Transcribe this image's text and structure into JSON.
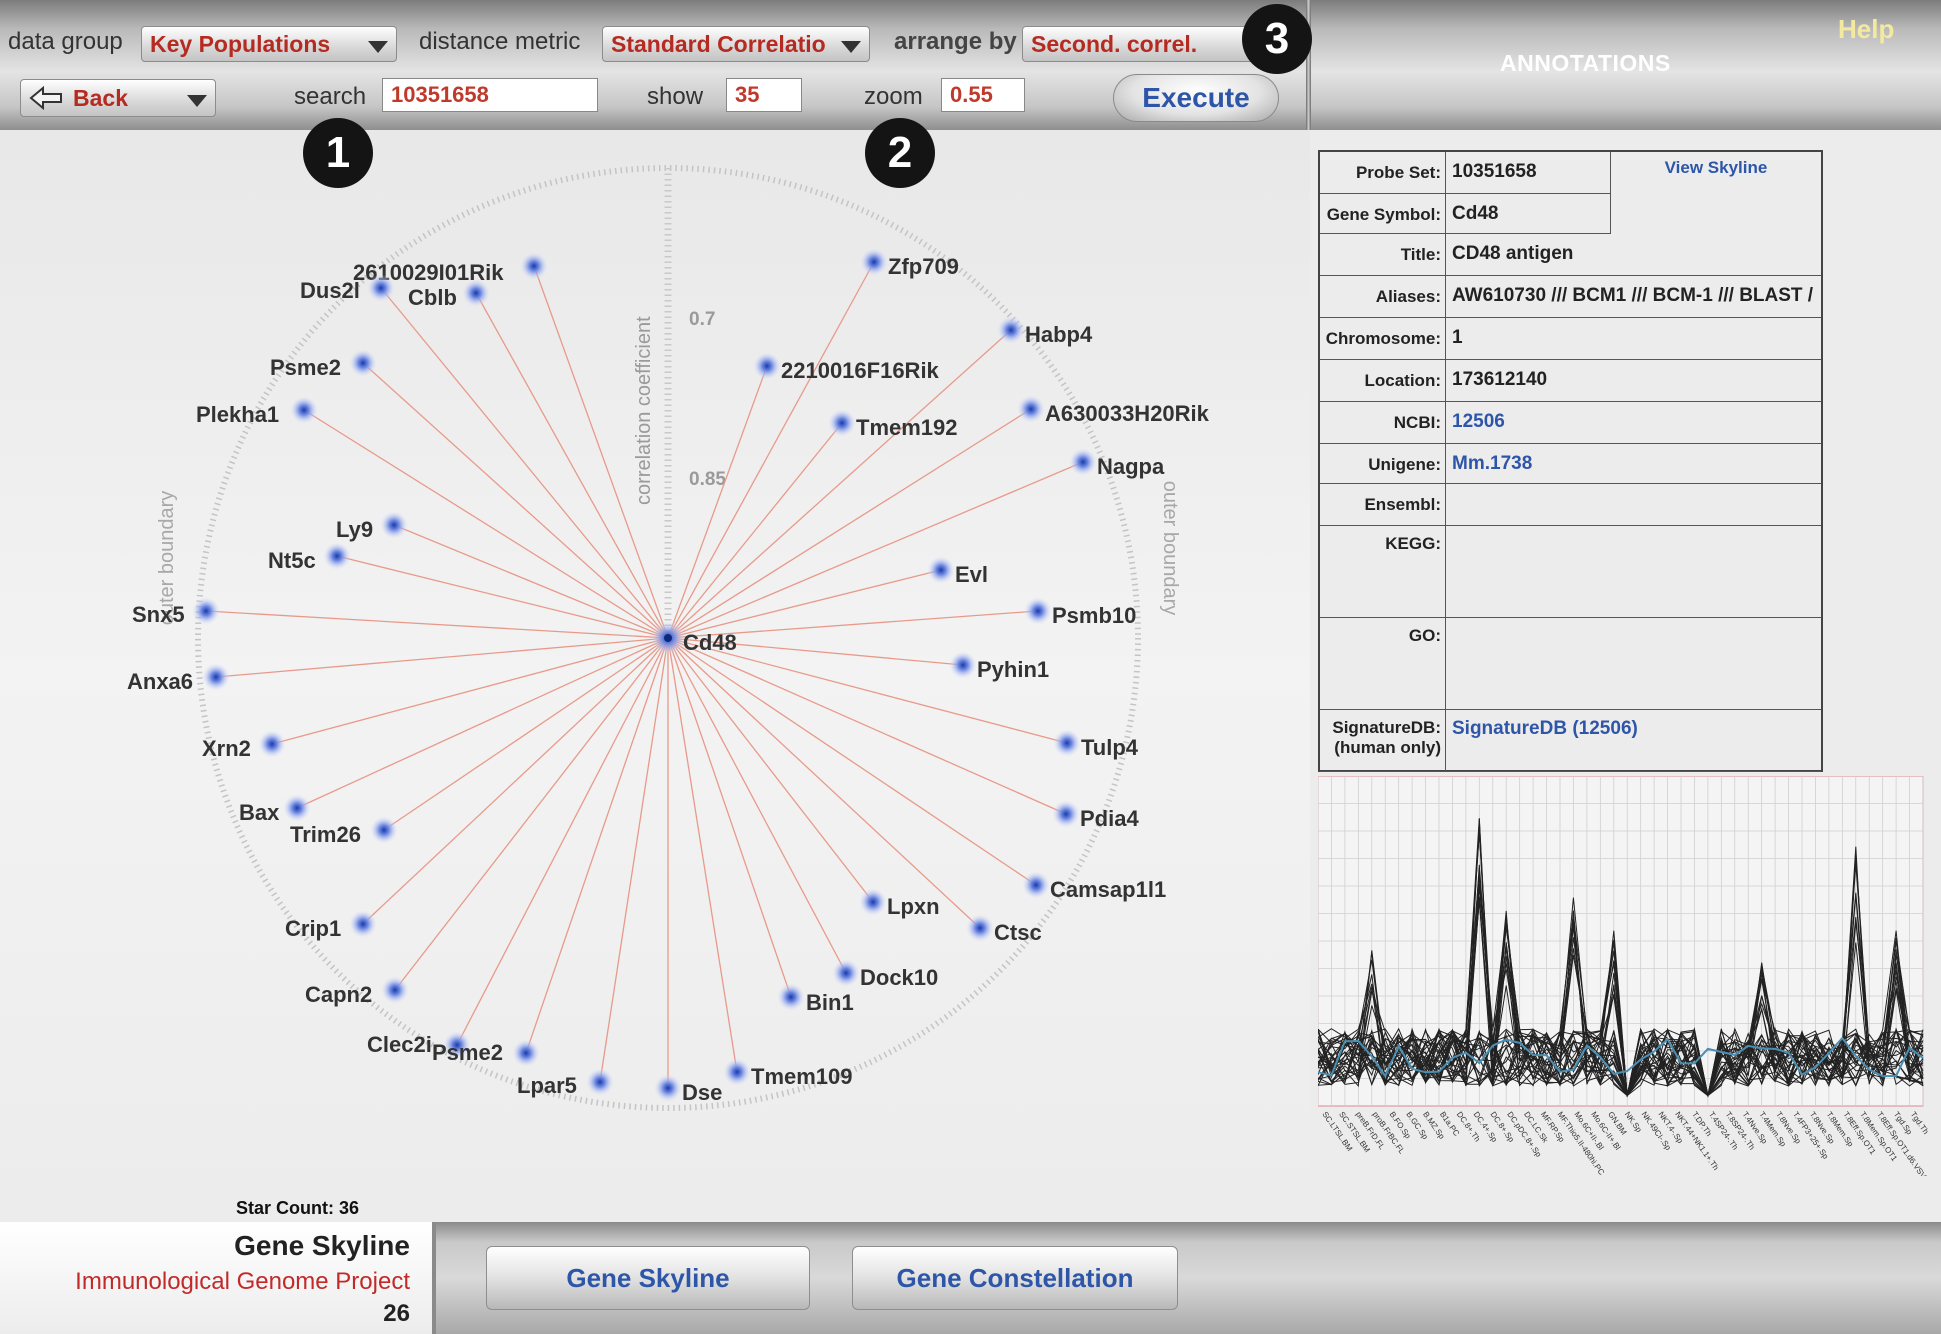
{
  "controls": {
    "data_group_label": "data group",
    "data_group_value": "Key Populations",
    "distance_metric_label": "distance metric",
    "distance_metric_value": "Standard Correlatio",
    "arrange_by_label": "arrange by",
    "arrange_by_value": "Second. correl.",
    "back_label": "Back",
    "search_label": "search",
    "search_value": "10351658",
    "show_label": "show",
    "show_value": "35",
    "zoom_label": "zoom",
    "zoom_value": "0.55",
    "execute_label": "Execute",
    "help_label": "Help",
    "annotations_title": "ANNOTATIONS"
  },
  "callouts": [
    "1",
    "2",
    "3"
  ],
  "constellation": {
    "center_gene": "Cd48",
    "axis_label": "correlation coefficient",
    "tick_07": "0.7",
    "tick_085": "0.85",
    "outer_boundary_left": "outer boundary",
    "outer_boundary_right": "outer boundary",
    "genes": [
      "2610029I01Rik",
      "Dus2l",
      "Cblb",
      "Psme2",
      "Plekha1",
      "Ly9",
      "Nt5c",
      "Snx5",
      "Anxa6",
      "Xrn2",
      "Bax",
      "Trim26",
      "Crip1",
      "Capn2",
      "Clec2i",
      "Psme2",
      "Lpar5",
      "Dse",
      "Tmem109",
      "Bin1",
      "Dock10",
      "Lpxn",
      "Ctsc",
      "Camsap1l1",
      "Pdia4",
      "Tulp4",
      "Pyhin1",
      "Psmb10",
      "Evl",
      "Nagpa",
      "A630033H20Rik",
      "Tmem192",
      "2210016F16Rik",
      "Habp4",
      "Zfp709"
    ]
  },
  "annotations": {
    "view_skyline": "View Skyline",
    "rows": [
      {
        "key": "Probe Set:",
        "value": "10351658",
        "link": false
      },
      {
        "key": "Gene Symbol:",
        "value": "Cd48",
        "link": false
      },
      {
        "key": "Title:",
        "value": "CD48 antigen",
        "link": false
      },
      {
        "key": "Aliases:",
        "value": "AW610730 /// BCM1 /// BCM-1 /// BLAST /",
        "link": false
      },
      {
        "key": "Chromosome:",
        "value": "1",
        "link": false
      },
      {
        "key": "Location:",
        "value": "173612140",
        "link": false
      },
      {
        "key": "NCBI:",
        "value": "12506",
        "link": true
      },
      {
        "key": "Unigene:",
        "value": "Mm.1738",
        "link": true
      },
      {
        "key": "Ensembl:",
        "value": "",
        "link": false
      },
      {
        "key": "KEGG:",
        "value": "",
        "link": false
      },
      {
        "key": "GO:",
        "value": "",
        "link": false
      },
      {
        "key": "SignatureDB:",
        "key2": "(human only)",
        "value": "SignatureDB (12506)",
        "link": true
      }
    ]
  },
  "skyline_labels": [
    "SC.LTSL.BM",
    "SC.STSL.BM",
    "preB.FrD.FL",
    "proB.FrBC.FL",
    "B.FO.Sp",
    "B.GC.Sp",
    "B.MZ.Sp",
    "B1a.PC",
    "DC.8+.Th",
    "DC.4+.Sp",
    "DC.8+.Sp",
    "DC.pDC.8+.Sp",
    "DC.LC.Sk",
    "MF.RP.Sp",
    "MF.Thio5.II-480hi.PC",
    "Mo.6C+II-.Bl",
    "Mo.6C-II+.Bl",
    "GN.BM",
    "NK.Sp",
    "NK.49CI-.Sp",
    "NKT.4-.Sp",
    "NKT.44+NK1.1+.Th",
    "T.DP.Th",
    "T.4SP24-.Th",
    "T.8SP24-.Th",
    "T.4Nve.Sp",
    "T.4Mem.Sp",
    "T.8Nve.Sp",
    "T.4FP3+25+.Sp",
    "T.8Nve.Sp",
    "T.8Mem.Sp",
    "T.8Eff.Sp.OT1",
    "T.8Mem.Sp.OT1",
    "T.8Eff.Sp.OT1.d6.VSVOva",
    "Tgd.Sp",
    "Tgd.Th"
  ],
  "footer": {
    "star_count": "Star Count: 36",
    "brand_title": "Gene Skyline",
    "brand_subtitle": "Immunological Genome Project",
    "page_number": "26",
    "btn_skyline": "Gene Skyline",
    "btn_constellation": "Gene Constellation"
  },
  "colors": {
    "accent_red": "#b52b22",
    "link_blue": "#2e56a8",
    "edge_color": "#e89a8a",
    "node_color": "#3a5fd0"
  }
}
